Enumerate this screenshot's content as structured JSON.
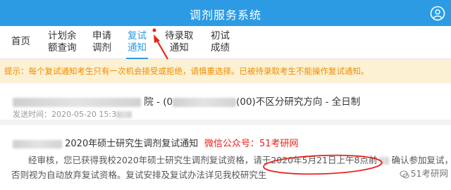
{
  "header": {
    "title": "调剂服务系统",
    "user_icon": "user-circle-icon"
  },
  "tabs": [
    {
      "label_line1": "首页",
      "label_line2": ""
    },
    {
      "label_line1": "计划余",
      "label_line2": "额查询"
    },
    {
      "label_line1": "申请",
      "label_line2": "调剂"
    },
    {
      "label_line1": "复试",
      "label_line2": "通知",
      "active": true
    },
    {
      "label_line1": "待录取",
      "label_line2": "通知"
    },
    {
      "label_line1": "初试",
      "label_line2": "成绩"
    }
  ],
  "notice": {
    "text": "提示：每个复试通知考生只有一次机会接受或拒绝，请慎重选择。已被待录取考生不能操作复试通知。"
  },
  "notification1": {
    "part1": "院 - (0",
    "part2": "(00)不区分研究方向 - 全日制",
    "sent_label": "发送时间：2020-05-20 15:3"
  },
  "notification2": {
    "heading": "2020年硕士研究生调剂复试通知",
    "wechat": "微信公众号：51考研网",
    "body_line1_a": "经审核，您已获得我校2020年硕士研究生调剂复试资格，请于",
    "body_line1_b": "2020年5月21日上午8点前",
    "body_line1_c": "确认参加复试，",
    "body_line2": "否则视为自动放弃复试资格。复试安排及复试办法详见我校研究生"
  },
  "watermark": {
    "text": "51考研网"
  },
  "colors": {
    "primary": "#2c9be3",
    "warning": "#f08c00",
    "notice_bg": "#fcf1d2",
    "annotation_red": "#e6231b"
  }
}
